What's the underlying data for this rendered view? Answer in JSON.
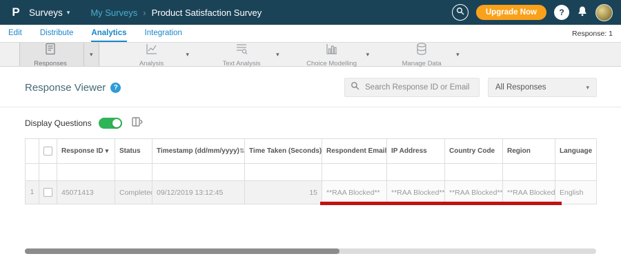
{
  "colors": {
    "header_bg": "#1b4357",
    "accent_blue": "#1a86c8",
    "upgrade_orange": "#f9a11b",
    "toggle_green": "#2fb457",
    "link_blue": "#2f9cd0",
    "annotation_red": "#c11212"
  },
  "icons": {
    "caret_down": "▾",
    "sort_both": "⇅",
    "help": "?",
    "breadcrumb_sep": "›"
  },
  "header": {
    "logo_letter": "P",
    "app_menu": "Surveys",
    "breadcrumb": {
      "parent": "My Surveys",
      "current": "Product Satisfaction Survey"
    },
    "upgrade_label": "Upgrade Now"
  },
  "nav": {
    "items": [
      {
        "label": "Edit"
      },
      {
        "label": "Distribute"
      },
      {
        "label": "Analytics"
      },
      {
        "label": "Integration"
      }
    ],
    "active": "Analytics",
    "response_count": "Response: 1"
  },
  "toolbar": {
    "items": [
      {
        "label": "Responses"
      },
      {
        "label": "Analysis"
      },
      {
        "label": "Text Analysis"
      },
      {
        "label": "Choice Modelling"
      },
      {
        "label": "Manage Data"
      }
    ],
    "active": "Responses"
  },
  "main": {
    "title": "Response Viewer",
    "search_placeholder": "Search Response ID or Email",
    "responses_filter": "All Responses",
    "display_questions_label": "Display Questions",
    "table": {
      "columns": [
        {
          "label": "Response ID"
        },
        {
          "label": "Status"
        },
        {
          "label": "Timestamp (dd/mm/yyyy)"
        },
        {
          "label": "Time Taken (Seconds)"
        },
        {
          "label": "Respondent Email"
        },
        {
          "label": "IP Address"
        },
        {
          "label": "Country Code"
        },
        {
          "label": "Region"
        },
        {
          "label": "Language"
        }
      ],
      "rows": [
        {
          "num": "1",
          "response_id": "45071413",
          "status": "Completed",
          "timestamp": "09/12/2019 13:12:45",
          "time_taken": "15",
          "respondent_email": "**RAA Blocked**",
          "ip_address": "**RAA Blocked**",
          "country_code": "**RAA Blocked**",
          "region": "**RAA Blocked**",
          "language": "English"
        }
      ]
    }
  }
}
